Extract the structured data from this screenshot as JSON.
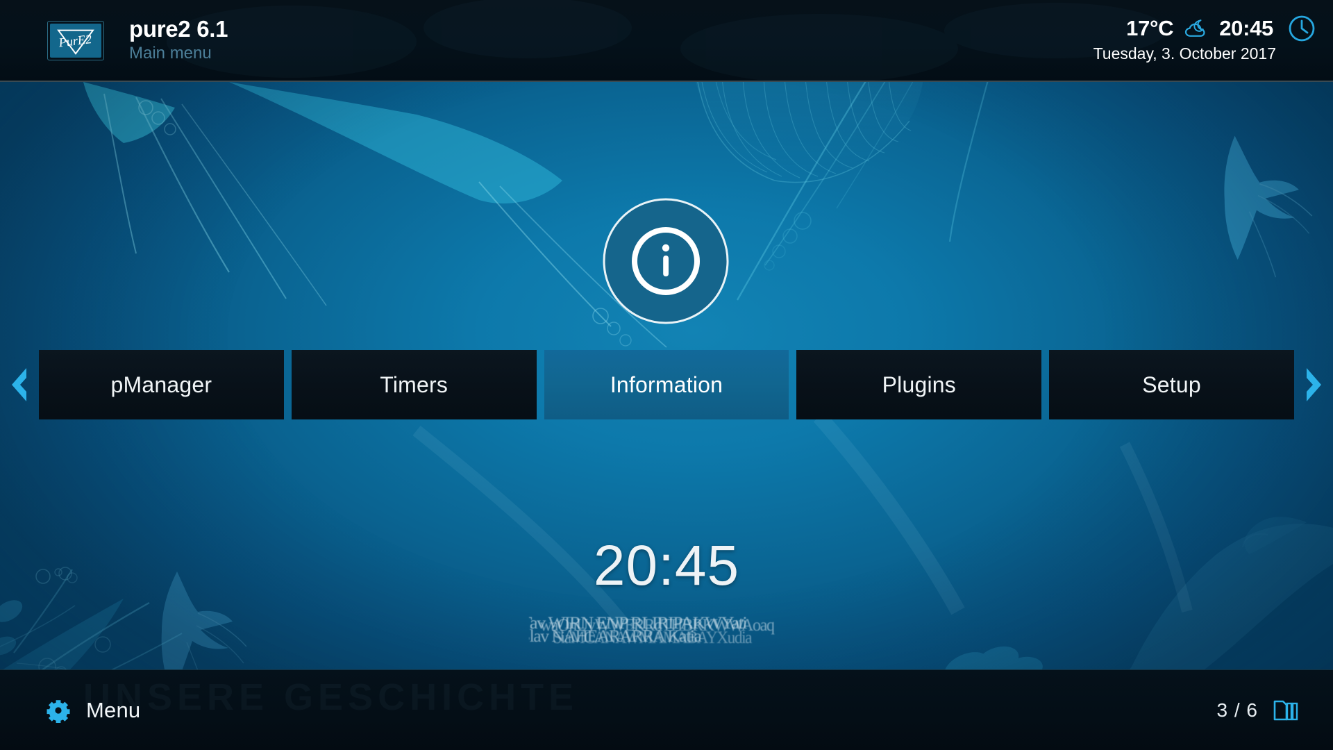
{
  "header": {
    "logo_alt": "pure2-logo",
    "logo_text": "PurE2",
    "title": "pure2 6.1",
    "subtitle": "Main menu",
    "temperature": "17°C",
    "weather_icon": "cloud-moon-icon",
    "time": "20:45",
    "clock_icon": "clock-icon",
    "date": "Tuesday,  3. October 2017"
  },
  "main": {
    "selected_icon": "info-circle-icon",
    "prev_arrow": "chevron-left-icon",
    "next_arrow": "chevron-right-icon",
    "menu_items": [
      {
        "label": "pManager",
        "selected": false
      },
      {
        "label": "Timers",
        "selected": false
      },
      {
        "label": "Information",
        "selected": true
      },
      {
        "label": "Plugins",
        "selected": false
      },
      {
        "label": "Setup",
        "selected": false
      }
    ],
    "big_clock": "20:45",
    "scrambled_overlay": [
      "Tav WIRN ENP RLIRIPAKWYati",
      "waOnUvWWERRdTHBRKWWAoaq",
      "Slav NAHEARARRA Katia",
      "SiaMCANAWMAMABAYXudia"
    ]
  },
  "footer": {
    "ghost_text": "UNSERE GESCHICHTE",
    "gear_icon": "gear-icon",
    "menu_label": "Menu",
    "page_indicator": "3 / 6",
    "pages_icon": "pages-stack-icon"
  },
  "colors": {
    "accent": "#29b6ec",
    "selected_tab": "#11658c",
    "tab_bg": "#081119",
    "header_bg": "#04111a",
    "bg_water": "#0d79ab",
    "subtitle": "#4c7f99"
  }
}
